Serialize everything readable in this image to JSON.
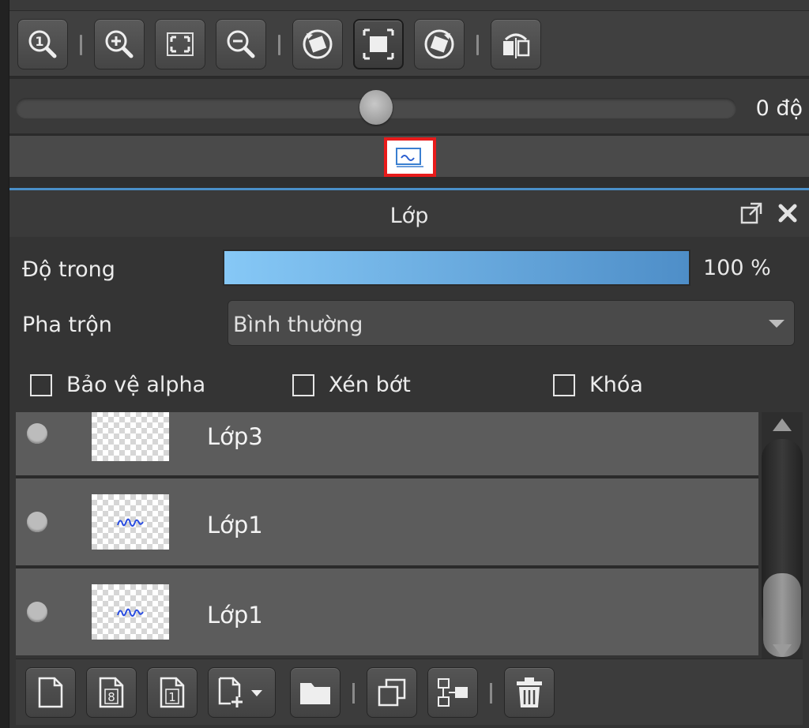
{
  "navigator": {
    "toolbar": [
      {
        "name": "zoom-actual-size-button",
        "icon": "zoom-1-icon"
      },
      {
        "name": "zoom-in-button",
        "icon": "zoom-in-icon"
      },
      {
        "name": "fit-to-window-button",
        "icon": "fit-screen-icon"
      },
      {
        "name": "zoom-out-button",
        "icon": "zoom-out-icon"
      },
      {
        "name": "rotate-left-button",
        "icon": "rotate-left-icon"
      },
      {
        "name": "fit-canvas-button",
        "icon": "fit-canvas-icon"
      },
      {
        "name": "rotate-right-button",
        "icon": "rotate-right-icon"
      },
      {
        "name": "flip-horizontal-button",
        "icon": "flip-horizontal-icon"
      }
    ],
    "rotation": {
      "value": 0.5,
      "label": "0 độ"
    }
  },
  "layer_panel": {
    "title": "Lớp",
    "opacity": {
      "label": "Độ trong",
      "value": 1.0,
      "value_text": "100 %"
    },
    "blend": {
      "label": "Pha trộn",
      "selected": "Bình thường"
    },
    "checkboxes": [
      {
        "label": "Bảo vệ alpha",
        "checked": false
      },
      {
        "label": "Xén bớt",
        "checked": false
      },
      {
        "label": "Khóa",
        "checked": false
      }
    ],
    "layers": [
      {
        "name": "Lớp3",
        "has_content": false,
        "visible": true
      },
      {
        "name": "Lớp1",
        "has_content": true,
        "visible": true
      },
      {
        "name": "Lớp1",
        "has_content": true,
        "visible": true
      }
    ],
    "bottom_toolbar": [
      {
        "name": "new-layer-button",
        "icon": "new-page-icon"
      },
      {
        "name": "new-8bit-layer-button",
        "icon": "page-8-icon"
      },
      {
        "name": "new-1bit-layer-button",
        "icon": "page-1-icon"
      },
      {
        "name": "add-layer-dropdown-button",
        "icon": "page-add-icon"
      },
      {
        "name": "new-folder-button",
        "icon": "folder-icon"
      },
      {
        "name": "duplicate-layer-button",
        "icon": "duplicate-icon"
      },
      {
        "name": "merge-layer-button",
        "icon": "merge-icon"
      },
      {
        "name": "delete-layer-button",
        "icon": "trash-icon"
      }
    ]
  },
  "colors": {
    "accent": "#4a8fc8",
    "selection": "#e81b1b",
    "opacity_fill": "#6aaee6"
  }
}
